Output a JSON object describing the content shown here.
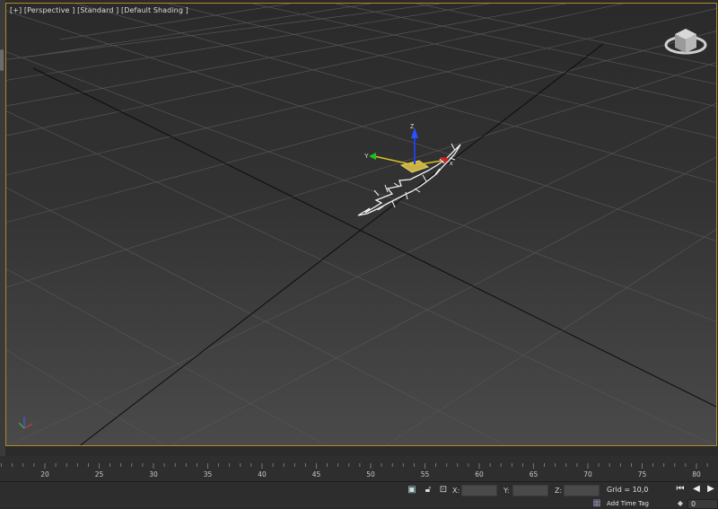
{
  "viewport": {
    "labels": [
      "[+]",
      "[Perspective ]",
      "[Standard ]",
      "[Default Shading ]"
    ],
    "border_color": "#b08a2a"
  },
  "gizmo": {
    "x_label": "x",
    "y_label": "Y",
    "z_label": "Z"
  },
  "timeline": {
    "ticks": [
      "20",
      "25",
      "30",
      "35",
      "40",
      "45",
      "50",
      "55",
      "60",
      "65",
      "70",
      "75",
      "80"
    ]
  },
  "status": {
    "icons": [
      "selection-lock-icon",
      "lock-icon",
      "absolute-mode-icon"
    ],
    "x_label": "X:",
    "y_label": "Y:",
    "z_label": "Z:",
    "x_value": "",
    "y_value": "",
    "z_value": "",
    "grid": "Grid = 10,0",
    "add_time_tag": "Add Time Tag",
    "frame": "0"
  },
  "colors": {
    "accent": "#b08a2a",
    "axis_x": "#d02020",
    "axis_y": "#20b020",
    "axis_z": "#2040e0"
  }
}
